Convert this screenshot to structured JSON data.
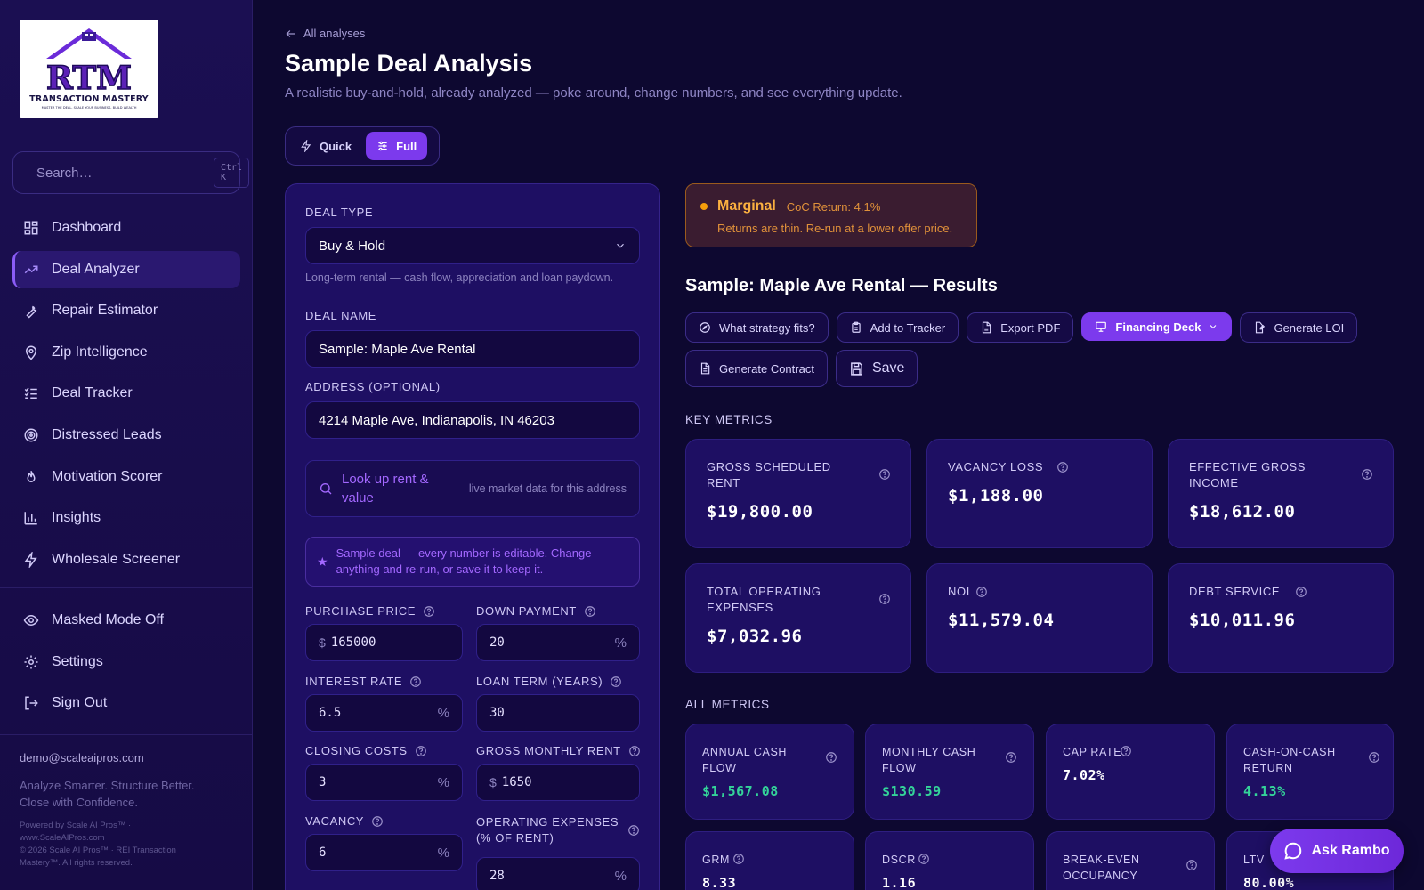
{
  "brand": {
    "logo_text": "TRANSACTION MASTERY",
    "logo_tagline": "MASTER THE DEAL. SCALE YOUR BUSINESS. BUILD WEALTH",
    "logo_mark": "RTM"
  },
  "sidebar": {
    "search_placeholder": "Search…",
    "search_shortcut": "Ctrl K",
    "items": [
      {
        "label": "Dashboard",
        "icon": "grid-icon"
      },
      {
        "label": "Deal Analyzer",
        "icon": "trending-up-icon",
        "active": true
      },
      {
        "label": "Repair Estimator",
        "icon": "wrench-icon"
      },
      {
        "label": "Zip Intelligence",
        "icon": "map-pin-icon"
      },
      {
        "label": "Deal Tracker",
        "icon": "list-checks-icon"
      },
      {
        "label": "Distressed Leads",
        "icon": "target-icon"
      },
      {
        "label": "Motivation Scorer",
        "icon": "flame-icon"
      },
      {
        "label": "Insights",
        "icon": "bar-chart-icon"
      },
      {
        "label": "Wholesale Screener",
        "icon": "zap-icon"
      }
    ],
    "secondary": [
      {
        "label": "Masked Mode Off",
        "icon": "eye-icon"
      },
      {
        "label": "Settings",
        "icon": "gear-icon"
      },
      {
        "label": "Sign Out",
        "icon": "log-out-icon"
      }
    ],
    "email": "demo@scaleaipros.com",
    "tagline_1": "Analyze Smarter. Structure Better.",
    "tagline_2": "Close with Confidence.",
    "legal_1": "Powered by Scale AI Pros™ ·",
    "legal_2": "www.ScaleAIPros.com",
    "legal_3": "© 2026 Scale AI Pros™ · REI Transaction",
    "legal_4": "Mastery™. All rights reserved."
  },
  "header": {
    "back_label": "All analyses",
    "title": "Sample Deal Analysis",
    "subtitle": "A realistic buy-and-hold, already analyzed — poke around, change numbers, and see everything update."
  },
  "mode": {
    "quick": "Quick",
    "full": "Full",
    "selected": "Full"
  },
  "form": {
    "deal_type_label": "DEAL TYPE",
    "deal_type_value": "Buy & Hold",
    "deal_type_help": "Long-term rental — cash flow, appreciation and loan paydown.",
    "deal_name_label": "DEAL NAME",
    "deal_name_value": "Sample: Maple Ave Rental",
    "address_label": "ADDRESS (OPTIONAL)",
    "address_value": "4214 Maple Ave, Indianapolis, IN 46203",
    "lookup_title": "Look up rent & value",
    "lookup_note": "live market data for this address",
    "notice": "Sample deal — every number is editable. Change anything and re-run, or save it to keep it.",
    "purchase_price_label": "PURCHASE PRICE",
    "purchase_price_value": "165000",
    "down_payment_label": "DOWN PAYMENT",
    "down_payment_value": "20",
    "interest_rate_label": "INTEREST RATE",
    "interest_rate_value": "6.5",
    "loan_term_label": "LOAN TERM (YEARS)",
    "loan_term_value": "30",
    "closing_costs_label": "CLOSING COSTS",
    "closing_costs_value": "3",
    "gross_rent_label": "GROSS MONTHLY RENT",
    "gross_rent_value": "1650",
    "vacancy_label": "VACANCY",
    "vacancy_value": "6",
    "opex_label_1": "OPERATING EXPENSES",
    "opex_label_2": "(% OF RENT)",
    "opex_value": "28",
    "currency_prefix": "$",
    "percent_suffix": "%"
  },
  "status": {
    "label": "Marginal",
    "coc": "CoC Return: 4.1%",
    "message": "Returns are thin. Re-run at a lower offer price.",
    "color": "#f59e0b"
  },
  "results": {
    "title": "Sample: Maple Ave Rental — Results",
    "actions": {
      "strategy": "What strategy fits?",
      "tracker": "Add to Tracker",
      "pdf": "Export PDF",
      "deck": "Financing Deck",
      "loi": "Generate LOI",
      "contract": "Generate Contract",
      "save": "Save"
    },
    "key_metrics_label": "KEY METRICS",
    "all_metrics_label": "ALL METRICS",
    "key_metrics": [
      {
        "label": "GROSS SCHEDULED RENT",
        "value": "$19,800.00"
      },
      {
        "label": "VACANCY LOSS",
        "value": "$1,188.00"
      },
      {
        "label": "EFFECTIVE GROSS INCOME",
        "value": "$18,612.00"
      },
      {
        "label": "TOTAL OPERATING EXPENSES",
        "value": "$7,032.96"
      },
      {
        "label": "NOI",
        "value": "$11,579.04"
      },
      {
        "label": "DEBT SERVICE",
        "value": "$10,011.96"
      }
    ],
    "all_metrics": [
      {
        "label": "ANNUAL CASH FLOW",
        "value": "$1,567.08"
      },
      {
        "label": "MONTHLY CASH FLOW",
        "value": "$130.59"
      },
      {
        "label": "CAP RATE",
        "value": "7.02%"
      },
      {
        "label": "CASH-ON-CASH RETURN",
        "value": "4.13%"
      },
      {
        "label": "GRM",
        "value": "8.33"
      },
      {
        "label": "DSCR",
        "value": "1.16"
      },
      {
        "label": "BREAK-EVEN OCCUPANCY",
        "value": ""
      },
      {
        "label": "LTV",
        "value": "80.00%"
      }
    ]
  },
  "assistant": {
    "label": "Ask Rambo"
  },
  "colors": {
    "accent": "#7c3aed",
    "positive": "#34d399",
    "warning": "#f59e0b",
    "background": "#0d0830"
  }
}
